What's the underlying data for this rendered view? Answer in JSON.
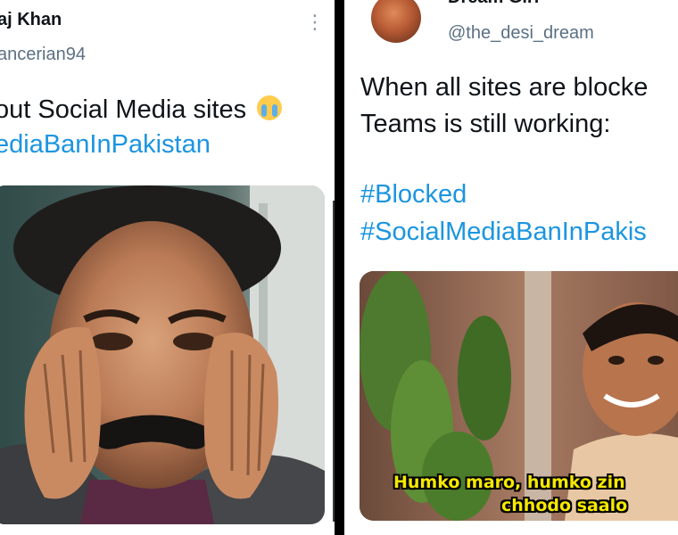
{
  "left_tweet": {
    "name": "aj Khan",
    "handle": "ancerian94",
    "text_line1": "out Social Media sites",
    "hashtag_line": "ediaBanInPakistan",
    "emoji_icon": "loudly-crying-face-icon",
    "more_icon": "more-vertical-icon"
  },
  "right_tweet": {
    "name": "Dream Girl",
    "handle": "@the_desi_dream",
    "text_line1": "When all sites are blocke",
    "text_line2": "Teams is still working:",
    "hashtag1": "#Blocked",
    "hashtag2": "#SocialMediaBanInPakis",
    "caption_line1": "Humko maro, humko zin",
    "caption_line2": "chhodo saalo"
  },
  "colors": {
    "link": "#1b95e0",
    "handle": "#5b7083",
    "text": "#0f1419",
    "caption": "#f5e800",
    "divider": "#000000"
  }
}
